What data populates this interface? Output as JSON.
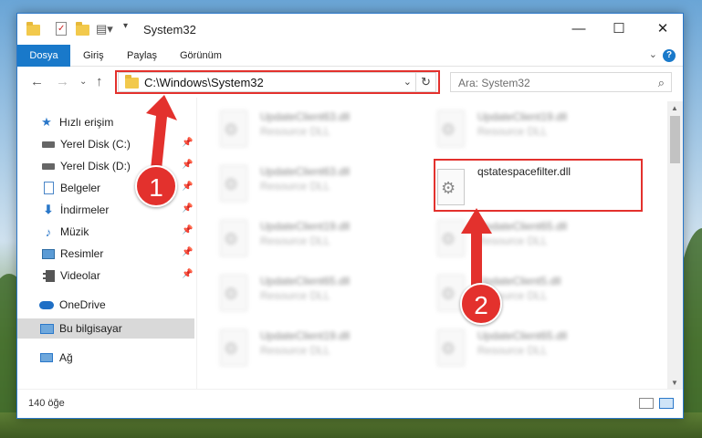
{
  "window": {
    "title": "System32",
    "minimize": "—",
    "maximize": "☐",
    "close": "✕"
  },
  "ribbon": {
    "tabs": [
      "Dosya",
      "Giriş",
      "Paylaş",
      "Görünüm"
    ]
  },
  "address": {
    "path": "C:\\Windows\\System32",
    "search_placeholder": "Ara: System32"
  },
  "sidebar": {
    "items": [
      {
        "label": "Hızlı erişim",
        "icon": "star-icon"
      },
      {
        "label": "Yerel Disk (C:)",
        "icon": "drive-icon"
      },
      {
        "label": "Yerel Disk (D:)",
        "icon": "drive-icon"
      },
      {
        "label": "Belgeler",
        "icon": "documents-icon"
      },
      {
        "label": "İndirmeler",
        "icon": "download-icon"
      },
      {
        "label": "Müzik",
        "icon": "music-icon"
      },
      {
        "label": "Resimler",
        "icon": "pictures-icon"
      },
      {
        "label": "Videolar",
        "icon": "videos-icon"
      },
      {
        "label": "OneDrive",
        "icon": "cloud-icon"
      },
      {
        "label": "Bu bilgisayar",
        "icon": "computer-icon"
      },
      {
        "label": "Ağ",
        "icon": "network-icon"
      }
    ]
  },
  "files": [
    {
      "name": "UpdateClient63.dll",
      "type": "Resource DLL"
    },
    {
      "name": "UpdateClient19.dll",
      "type": "Resource DLL"
    },
    {
      "name": "UpdateClient63.dll",
      "type": "Resource DLL"
    },
    {
      "name": "qstatespacefilter.dll",
      "type": ""
    },
    {
      "name": "UpdateClient19.dll",
      "type": "Resource DLL"
    },
    {
      "name": "UpdateClient65.dll",
      "type": "Resource DLL"
    },
    {
      "name": "UpdateClient65.dll",
      "type": "Resource DLL"
    },
    {
      "name": "UpdateClient5.dll",
      "type": "Resource DLL"
    },
    {
      "name": "UpdateClient19.dll",
      "type": "Resource DLL"
    },
    {
      "name": "UpdateClient65.dll",
      "type": "Resource DLL"
    }
  ],
  "status": {
    "count": "140 öğe"
  },
  "annotations": {
    "step1": "1",
    "step2": "2",
    "color": "#e3312d"
  }
}
